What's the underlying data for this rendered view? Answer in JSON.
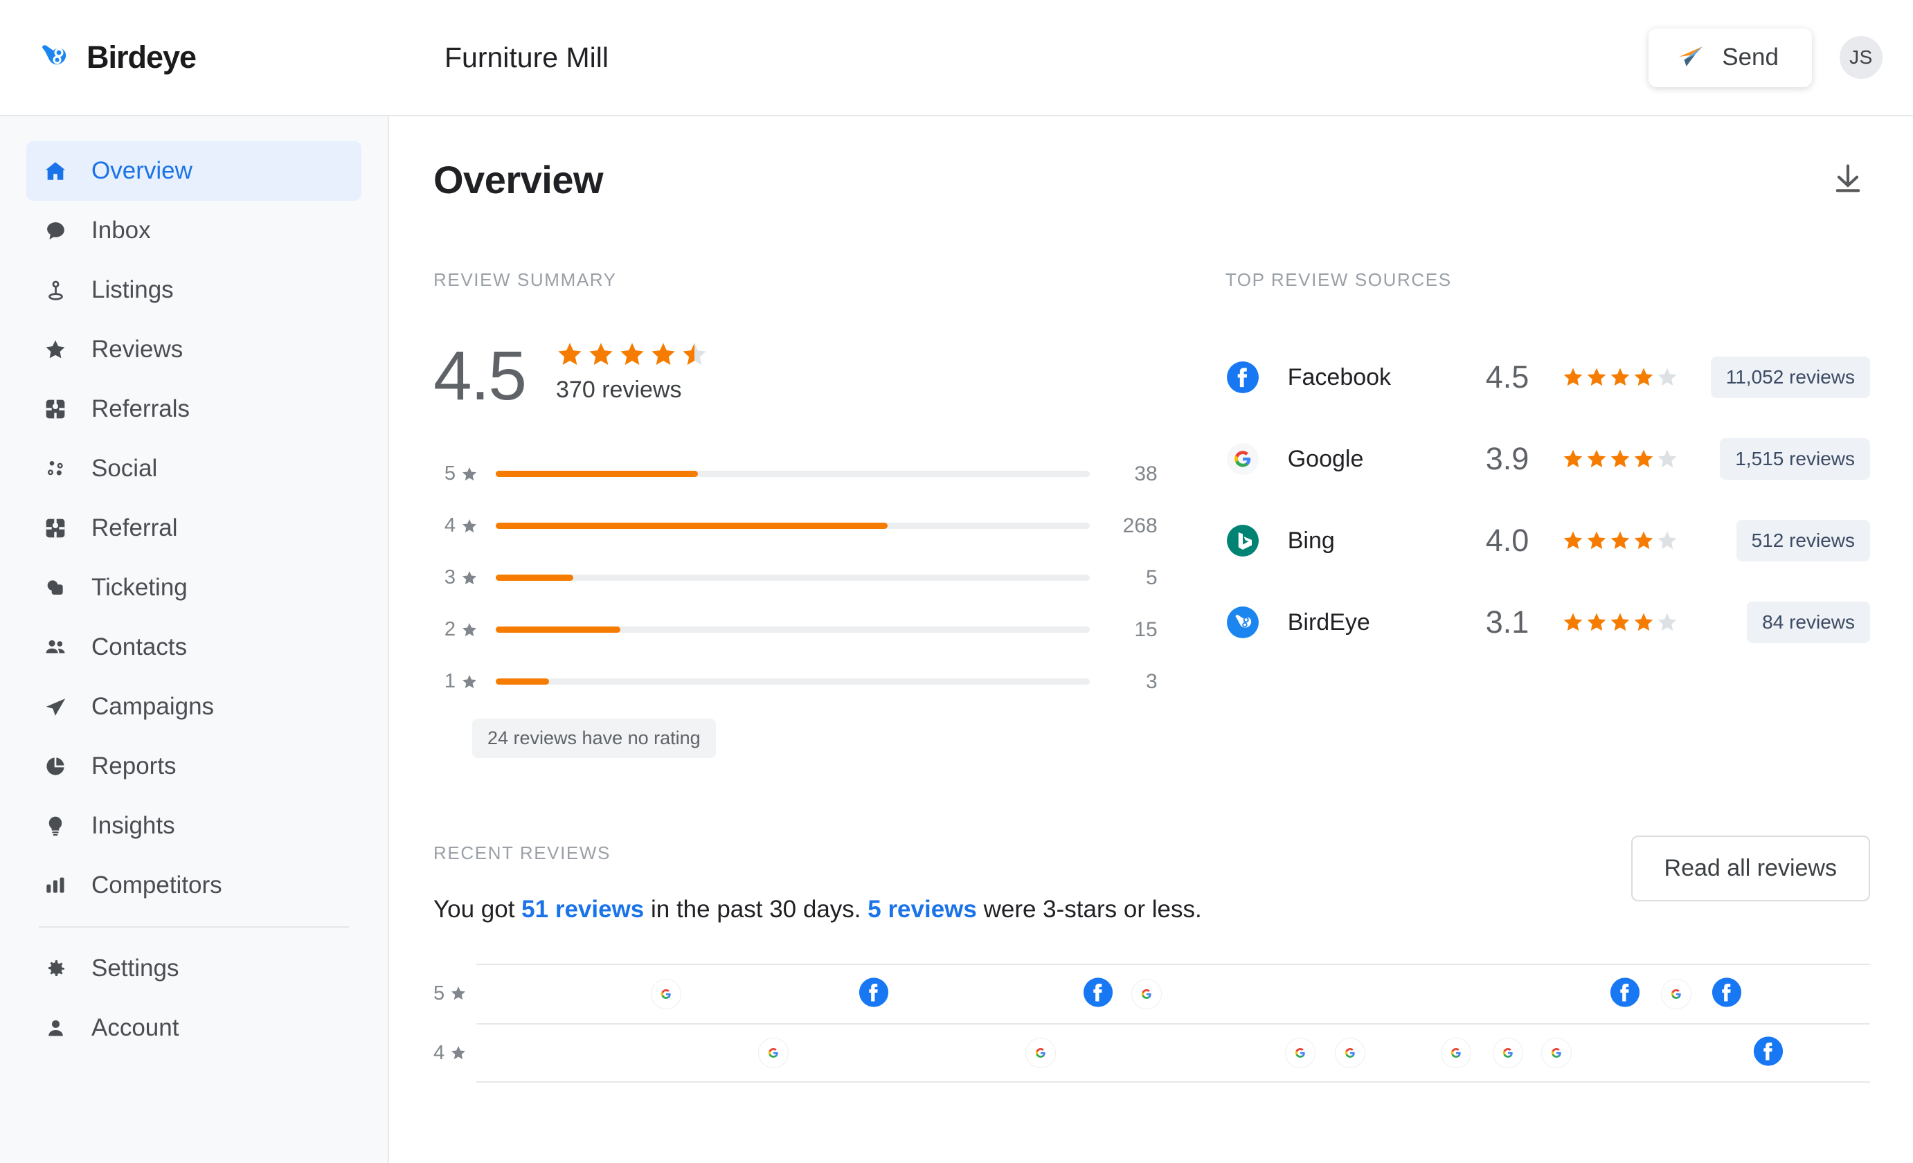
{
  "brand": {
    "name": "Birdeye",
    "logo_icon": "birdeye-bird-icon"
  },
  "header": {
    "account_name": "Furniture Mill",
    "send_label": "Send",
    "send_icon": "paper-plane-icon",
    "avatar_initials": "JS"
  },
  "sidebar": {
    "items": [
      {
        "label": "Overview",
        "icon": "home-icon",
        "active": true
      },
      {
        "label": "Inbox",
        "icon": "chat-bubble-icon",
        "active": false
      },
      {
        "label": "Listings",
        "icon": "map-pin-icon",
        "active": false
      },
      {
        "label": "Reviews",
        "icon": "star-icon",
        "active": false
      },
      {
        "label": "Referrals",
        "icon": "gift-icon",
        "active": false
      },
      {
        "label": "Social",
        "icon": "social-dots-icon",
        "active": false
      },
      {
        "label": "Referral",
        "icon": "gift-icon",
        "active": false
      },
      {
        "label": "Ticketing",
        "icon": "tickets-icon",
        "active": false
      },
      {
        "label": "Contacts",
        "icon": "people-icon",
        "active": false
      },
      {
        "label": "Campaigns",
        "icon": "paper-plane-icon",
        "active": false
      },
      {
        "label": "Reports",
        "icon": "pie-chart-icon",
        "active": false
      },
      {
        "label": "Insights",
        "icon": "lightbulb-icon",
        "active": false
      },
      {
        "label": "Competitors",
        "icon": "bar-chart-icon",
        "active": false
      }
    ],
    "footer_items": [
      {
        "label": "Settings",
        "icon": "gear-icon"
      },
      {
        "label": "Account",
        "icon": "person-icon"
      }
    ]
  },
  "main": {
    "page_title": "Overview",
    "download_icon": "download-icon",
    "review_summary": {
      "label": "REVIEW SUMMARY",
      "score": "4.5",
      "stars_filled": 4.5,
      "review_count_text": "370 reviews",
      "no_rating_note": "24 reviews have no rating",
      "distribution": [
        {
          "stars": "5",
          "count": "38",
          "pct": 34
        },
        {
          "stars": "4",
          "count": "268",
          "pct": 66
        },
        {
          "stars": "3",
          "count": "5",
          "pct": 13
        },
        {
          "stars": "2",
          "count": "15",
          "pct": 21
        },
        {
          "stars": "1",
          "count": "3",
          "pct": 9
        }
      ]
    },
    "top_review_sources": {
      "label": "TOP REVIEW SOURCES",
      "sources": [
        {
          "name": "Facebook",
          "icon": "facebook-icon",
          "rating": "4.5",
          "stars_filled": 4,
          "reviews": "11,052 reviews"
        },
        {
          "name": "Google",
          "icon": "google-icon",
          "rating": "3.9",
          "stars_filled": 4,
          "reviews": "1,515 reviews"
        },
        {
          "name": "Bing",
          "icon": "bing-icon",
          "rating": "4.0",
          "stars_filled": 4,
          "reviews": "512 reviews"
        },
        {
          "name": "BirdEye",
          "icon": "birdeye-icon",
          "rating": "3.1",
          "stars_filled": 4,
          "reviews": "84 reviews"
        }
      ]
    },
    "recent_reviews": {
      "label": "RECENT REVIEWS",
      "sentence_part1": "You got ",
      "link1": "51 reviews",
      "sentence_part2": " in the past 30 days. ",
      "link2": "5 reviews",
      "sentence_part3": " were 3-stars or less.",
      "read_all_label": "Read all reviews",
      "rows": [
        {
          "stars": "5",
          "markers": [
            {
              "icon": "google-icon",
              "x_pct": 13.6
            },
            {
              "icon": "facebook-icon",
              "x_pct": 28.5
            },
            {
              "icon": "facebook-icon",
              "x_pct": 44.6
            },
            {
              "icon": "google-icon",
              "x_pct": 48.1
            },
            {
              "icon": "facebook-icon",
              "x_pct": 82.4
            },
            {
              "icon": "google-icon",
              "x_pct": 86.1
            },
            {
              "icon": "facebook-icon",
              "x_pct": 89.7
            }
          ]
        },
        {
          "stars": "4",
          "markers": [
            {
              "icon": "google-icon",
              "x_pct": 21.3
            },
            {
              "icon": "google-icon",
              "x_pct": 40.5
            },
            {
              "icon": "google-icon",
              "x_pct": 59.1
            },
            {
              "icon": "google-icon",
              "x_pct": 62.7
            },
            {
              "icon": "google-icon",
              "x_pct": 70.3
            },
            {
              "icon": "google-icon",
              "x_pct": 74.0
            },
            {
              "icon": "google-icon",
              "x_pct": 77.5
            },
            {
              "icon": "facebook-icon",
              "x_pct": 92.7
            }
          ]
        }
      ]
    }
  },
  "colors": {
    "accent_blue": "#1a73e8",
    "star_orange": "#f57c00",
    "star_gray": "#dadce0",
    "bar_orange": "#f57c00",
    "facebook_blue": "#1877f2",
    "bing_green": "#008373"
  }
}
